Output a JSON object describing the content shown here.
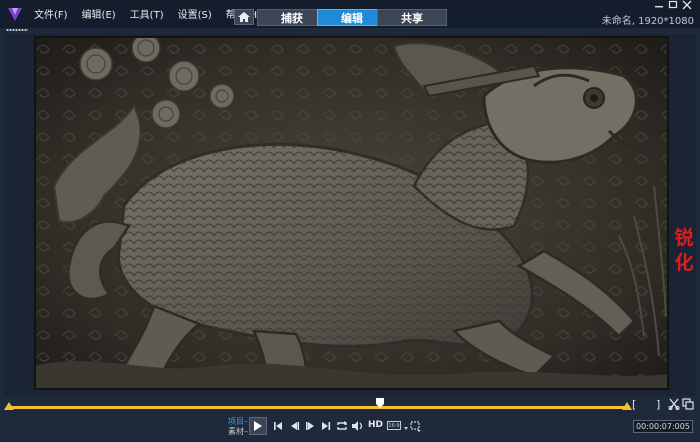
{
  "app": {
    "menu": [
      "文件(F)",
      "编辑(E)",
      "工具(T)",
      "设置(S)",
      "帮助(H)"
    ],
    "tabs": [
      "捕获",
      "编辑",
      "共享"
    ],
    "active_tab": "编辑",
    "project_info": "未命名, 1920*1080",
    "accent_color": "#1f8ad6"
  },
  "preview": {
    "overlay_label": "锐化",
    "overlay_color": "#e01c1c"
  },
  "player": {
    "mode_project": "项目–",
    "mode_clip": "素材–",
    "hd_label": "HD",
    "aspect_label": "16:9",
    "timecode": "00:00:07:005",
    "icons": [
      "play-icon",
      "go-to-start-icon",
      "prev-frame-icon",
      "next-frame-icon",
      "go-to-end-icon",
      "repeat-icon",
      "volume-icon",
      "hd-toggle",
      "aspect-ratio-icon",
      "crop-icon",
      "split-clip-icon",
      "copy-icon"
    ]
  },
  "scrubber": {
    "mark_in": "[",
    "mark_out": "]"
  }
}
